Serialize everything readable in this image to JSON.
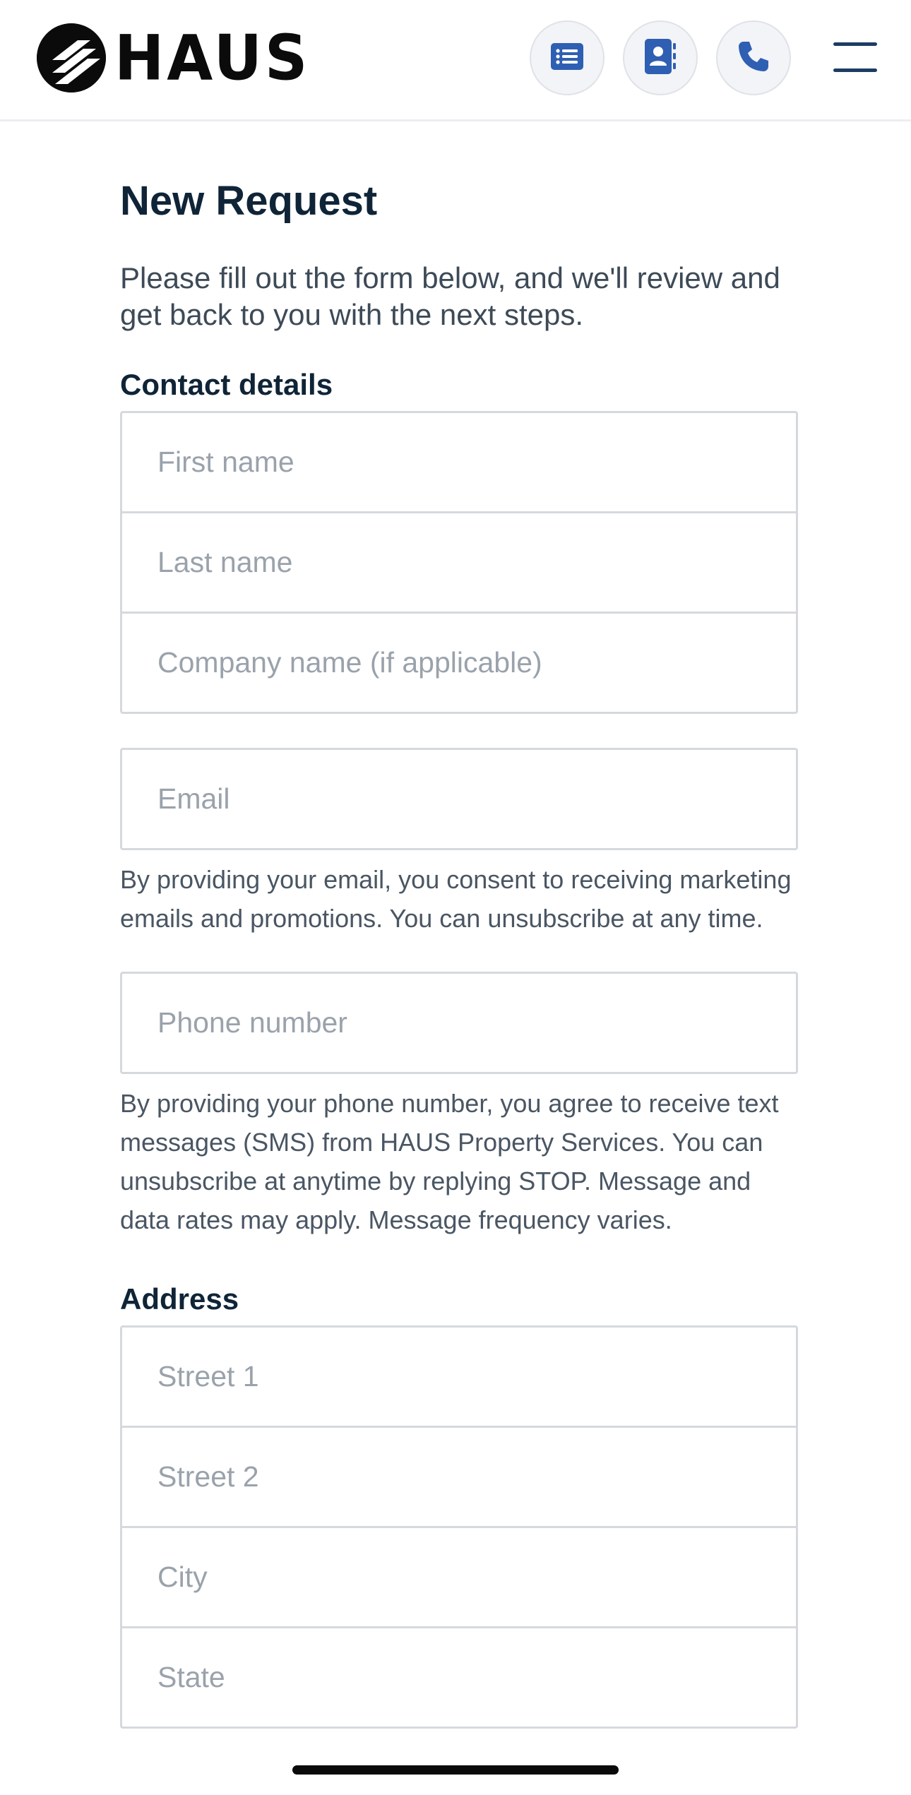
{
  "brand": {
    "name": "HAUS"
  },
  "header": {
    "icons": [
      "list-icon",
      "contact-card-icon",
      "phone-icon",
      "menu-icon"
    ],
    "accent_color": "#2f5fb3"
  },
  "form": {
    "title": "New Request",
    "intro": "Please fill out the form below, and we'll review and get back to you with the next steps.",
    "contact_section_label": "Contact details",
    "first_name_placeholder": "First name",
    "last_name_placeholder": "Last name",
    "company_placeholder": "Company name (if applicable)",
    "email_placeholder": "Email",
    "email_consent": "By providing your email, you consent to receiving marketing emails and promotions. You can unsubscribe at any time.",
    "phone_placeholder": "Phone number",
    "phone_consent": "By providing your phone number, you agree to receive text messages (SMS) from HAUS Property Services. You can unsubscribe at anytime by replying STOP. Message and data rates may apply. Message frequency varies.",
    "address_section_label": "Address",
    "street1_placeholder": "Street 1",
    "street2_placeholder": "Street 2",
    "city_placeholder": "City",
    "state_placeholder": "State"
  }
}
